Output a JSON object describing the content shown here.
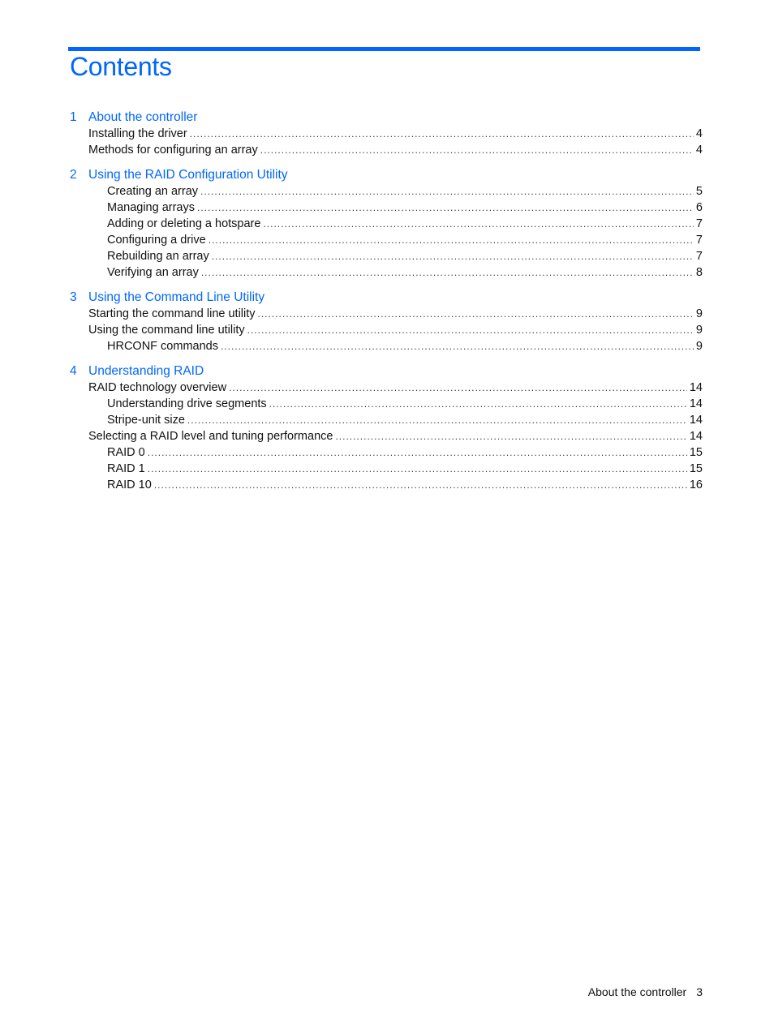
{
  "document": {
    "title": "Contents",
    "accent_color": "#0066ff",
    "chapters": [
      {
        "number": "1",
        "title": "About the controller",
        "entries": [
          {
            "label": "Installing the driver",
            "page": "4",
            "level": 1
          },
          {
            "label": "Methods for configuring an array",
            "page": "4",
            "level": 1
          }
        ]
      },
      {
        "number": "2",
        "title": "Using the RAID Configuration Utility",
        "entries": [
          {
            "label": "Creating an array",
            "page": "5",
            "level": 2
          },
          {
            "label": "Managing arrays",
            "page": "6",
            "level": 2
          },
          {
            "label": "Adding or deleting a hotspare",
            "page": "7",
            "level": 2
          },
          {
            "label": "Configuring a drive",
            "page": "7",
            "level": 2
          },
          {
            "label": "Rebuilding an array",
            "page": "7",
            "level": 2
          },
          {
            "label": "Verifying an array",
            "page": "8",
            "level": 2
          }
        ]
      },
      {
        "number": "3",
        "title": "Using the Command Line Utility",
        "entries": [
          {
            "label": "Starting the command line utility",
            "page": "9",
            "level": 1
          },
          {
            "label": "Using the command line utility",
            "page": "9",
            "level": 1
          },
          {
            "label": "HRCONF commands",
            "page": "9",
            "level": 2
          }
        ]
      },
      {
        "number": "4",
        "title": "Understanding RAID",
        "entries": [
          {
            "label": "RAID technology overview",
            "page": "14",
            "level": 1
          },
          {
            "label": "Understanding drive segments",
            "page": "14",
            "level": 2
          },
          {
            "label": "Stripe-unit size",
            "page": "14",
            "level": 2
          },
          {
            "label": "Selecting a RAID level and tuning performance",
            "page": "14",
            "level": 1
          },
          {
            "label": "RAID 0",
            "page": "15",
            "level": 2
          },
          {
            "label": "RAID 1",
            "page": "15",
            "level": 2
          },
          {
            "label": "RAID 10",
            "page": "16",
            "level": 2
          }
        ]
      }
    ],
    "footer": {
      "section": "About the controller",
      "page": "3"
    }
  }
}
